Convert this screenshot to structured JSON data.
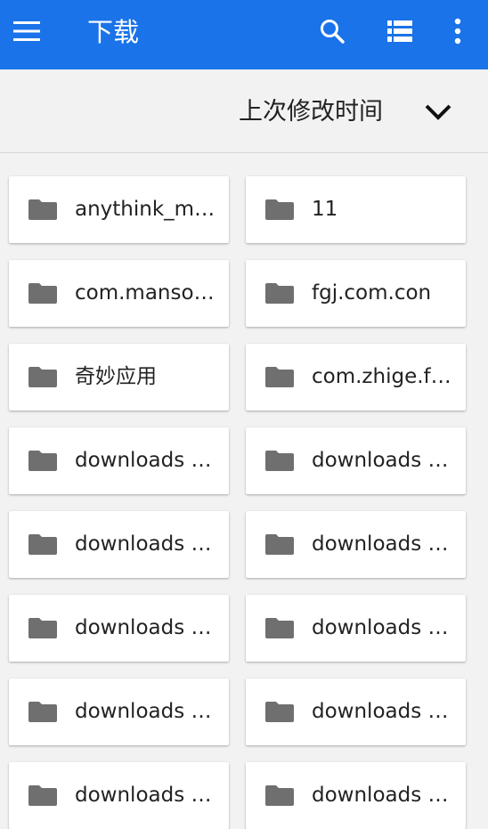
{
  "appbar": {
    "title": "下载",
    "color": "#1a73e8",
    "menu_icon": "menu-icon",
    "search_icon": "search-icon",
    "view_icon": "list-view-icon",
    "more_icon": "more-vert-icon"
  },
  "sortbar": {
    "label": "上次修改时间",
    "toggle_icon": "chevron-down-icon"
  },
  "folders": [
    {
      "name": "anythink_m…"
    },
    {
      "name": "11"
    },
    {
      "name": "com.manso…"
    },
    {
      "name": "fgj.com.con"
    },
    {
      "name": "奇妙应用"
    },
    {
      "name": "com.zhige.f…"
    },
    {
      "name": "downloads (…"
    },
    {
      "name": "downloads (…"
    },
    {
      "name": "downloads (…"
    },
    {
      "name": "downloads (…"
    },
    {
      "name": "downloads (…"
    },
    {
      "name": "downloads (…"
    },
    {
      "name": "downloads (…"
    },
    {
      "name": "downloads (…"
    },
    {
      "name": "downloads (…"
    },
    {
      "name": "downloads (…"
    }
  ]
}
